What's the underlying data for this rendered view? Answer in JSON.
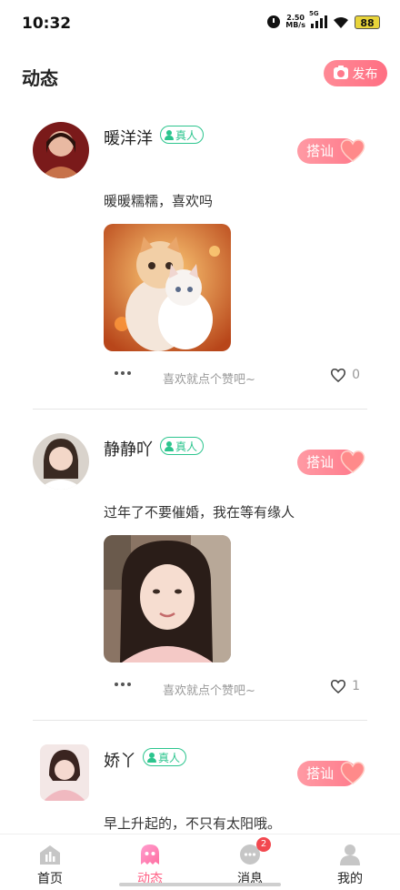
{
  "status_bar": {
    "time": "10:32",
    "net_speed_value": "2.50",
    "net_speed_unit": "MB/s",
    "network": "5G",
    "battery": "88"
  },
  "header": {
    "title": "动态",
    "publish_label": "发布"
  },
  "posts": [
    {
      "username": "暖洋洋",
      "verified_label": "真人",
      "chat_label": "搭讪",
      "text": "暖暖糯糯，喜欢吗",
      "like_hint": "喜欢就点个赞吧~",
      "like_count": "0",
      "image": "two-kittens-photo",
      "avatar": "woman-avatar-red"
    },
    {
      "username": "静静吖",
      "verified_label": "真人",
      "chat_label": "搭讪",
      "text": "过年了不要催婚，我在等有缘人",
      "like_hint": "喜欢就点个赞吧~",
      "like_count": "1",
      "image": "woman-selfie-photo",
      "avatar": "woman-avatar-light"
    },
    {
      "username": "娇丫",
      "verified_label": "真人",
      "chat_label": "搭讪",
      "text": "早上升起的，不只有太阳哦。",
      "avatar": "woman-avatar-pink"
    }
  ],
  "bottom_nav": {
    "items": [
      {
        "label": "首页",
        "icon": "home-icon"
      },
      {
        "label": "动态",
        "icon": "moments-icon",
        "active": true
      },
      {
        "label": "消息",
        "icon": "message-icon",
        "badge": "2"
      },
      {
        "label": "我的",
        "icon": "profile-icon"
      }
    ]
  },
  "colors": {
    "accent": "#ff6f83",
    "verified": "#2cc58e",
    "active_nav": "#ff5f84"
  }
}
